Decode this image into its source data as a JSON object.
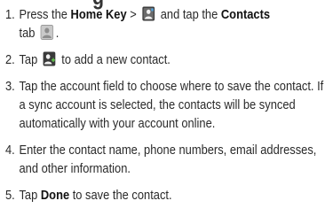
{
  "heading_fragment": "g",
  "steps": [
    {
      "number": "1.",
      "parts": {
        "a": "Press the ",
        "b_bold": "Home Key",
        "c": " > ",
        "d": " and tap the ",
        "e_bold": "Contacts",
        "f": " tab ",
        "g": "."
      }
    },
    {
      "number": "2.",
      "parts": {
        "a": "Tap ",
        "b": " to add a new contact."
      }
    },
    {
      "number": "3.",
      "text": "Tap the account field to choose where to save the contact. If a sync account is selected, the contacts will be synced automatically with your account online."
    },
    {
      "number": "4.",
      "text": "Enter the contact name, phone numbers, email addresses, and other information."
    },
    {
      "number": "5.",
      "parts": {
        "a": "Tap ",
        "b_bold": "Done",
        "c": " to save the contact."
      }
    }
  ],
  "icons": {
    "apps": "apps-launcher-icon",
    "contacts_tab": "contacts-tab-icon",
    "add_contact": "add-contact-icon"
  }
}
